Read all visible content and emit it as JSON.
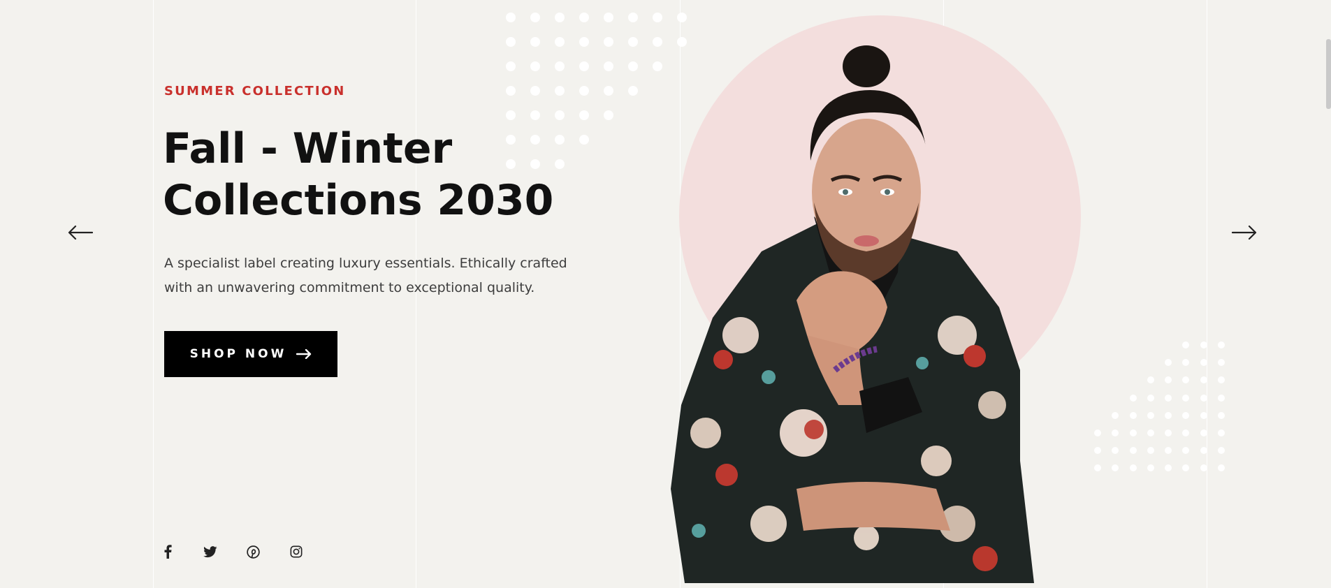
{
  "hero": {
    "subtitle": "SUMMER COLLECTION",
    "title_line1": "Fall - Winter",
    "title_line2": "Collections 2030",
    "description_line1": "A specialist label creating luxury essentials. Ethically crafted",
    "description_line2": "with an unwavering commitment to exceptional quality.",
    "cta_label": "SHOP NOW"
  },
  "navigation": {
    "prev_icon": "arrow-left-icon",
    "next_icon": "arrow-right-icon"
  },
  "social": [
    {
      "name": "facebook-icon"
    },
    {
      "name": "twitter-icon"
    },
    {
      "name": "pinterest-icon"
    },
    {
      "name": "instagram-icon"
    }
  ],
  "colors": {
    "background": "#f3f2ee",
    "accent": "#c9302c",
    "circle": "#f3dedd",
    "button": "#000000"
  }
}
